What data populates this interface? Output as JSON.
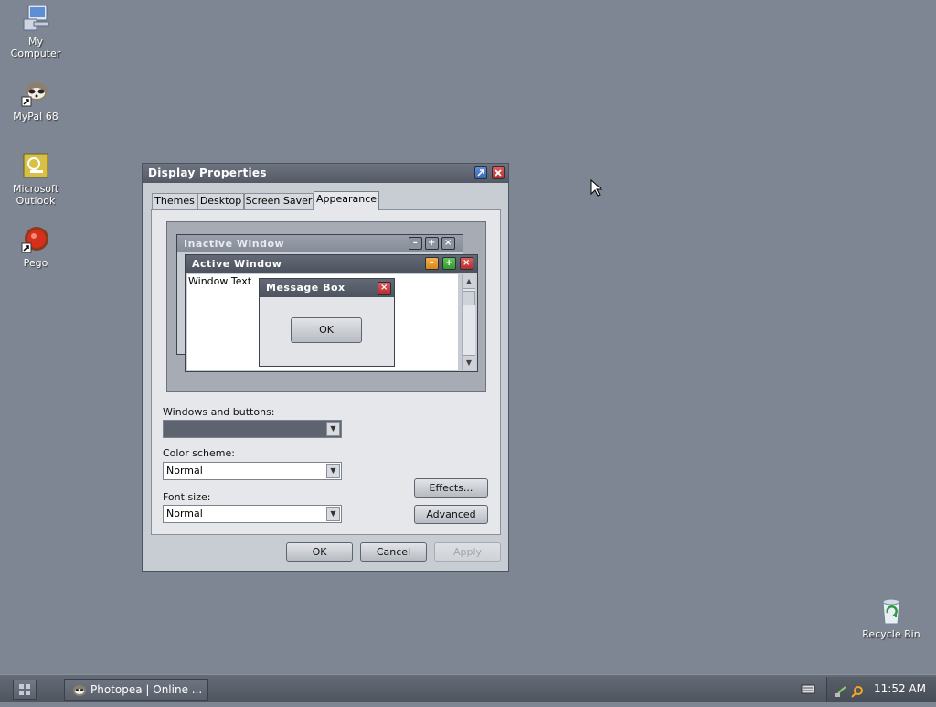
{
  "desktop": {
    "icons": [
      {
        "label_line1": "My",
        "label_line2": "Computer",
        "icon": "computer-icon"
      },
      {
        "label_line1": "MyPal 68",
        "icon": "raccoon-browser-icon"
      },
      {
        "label_line1": "Microsoft",
        "label_line2": "Outlook",
        "icon": "outlook-icon"
      },
      {
        "label_line1": "Pego",
        "icon": "pego-icon"
      },
      {
        "label_line1": "Recycle Bin",
        "icon": "recycle-bin-icon"
      }
    ]
  },
  "dialog": {
    "title": "Display Properties",
    "tabs": [
      "Themes",
      "Desktop",
      "Screen Saver",
      "Appearance"
    ],
    "active_tab": "Appearance",
    "preview": {
      "inactive_title": "Inactive Window",
      "active_title": "Active Window",
      "window_text": "Window Text",
      "message_title": "Message Box",
      "message_button": "OK"
    },
    "windows_buttons_label": "Windows and buttons:",
    "windows_buttons_value": "",
    "color_scheme_label": "Color scheme:",
    "color_scheme_value": "Normal",
    "font_size_label": "Font size:",
    "font_size_value": "Normal",
    "effects_button": "Effects...",
    "advanced_button": "Advanced",
    "ok_button": "OK",
    "cancel_button": "Cancel",
    "apply_button": "Apply"
  },
  "taskbar": {
    "task_label": "Photopea | Online ...",
    "clock": "11:52 AM"
  },
  "colors": {
    "desktop": "#7e8693",
    "active_title": "#4f5662",
    "close_red": "#c83c3c",
    "maximize_green": "#3ea838",
    "minimize_orange": "#e49a2a"
  }
}
